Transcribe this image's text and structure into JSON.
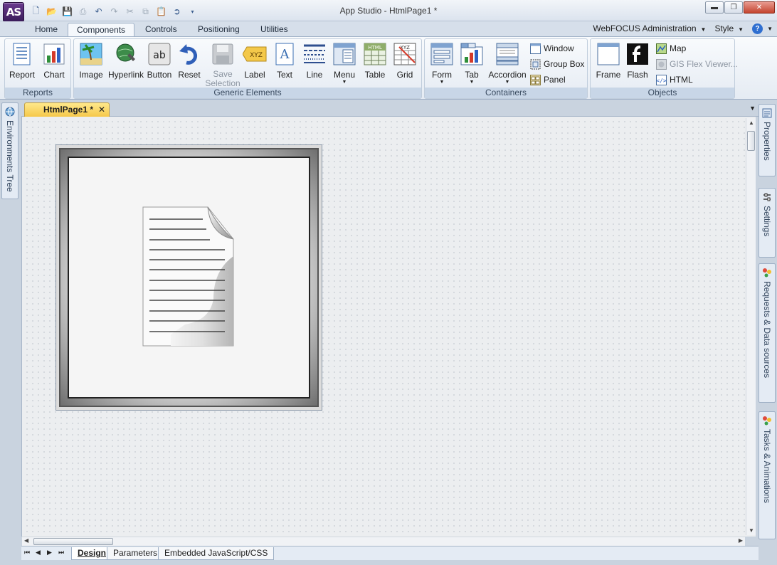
{
  "app": {
    "logo_text": "AS",
    "window_title": "App Studio - HtmlPage1 *"
  },
  "quick_access": [
    "new-icon",
    "open-icon",
    "save-icon",
    "print-icon",
    "undo-icon",
    "redo-icon",
    "cut-icon",
    "copy-icon",
    "paste-icon",
    "publish-icon",
    "more-icon"
  ],
  "window_controls": {
    "minimize": "▬",
    "restore": "❐",
    "close": "✕"
  },
  "ribbon_tabs": [
    "Home",
    "Components",
    "Controls",
    "Positioning",
    "Utilities"
  ],
  "active_tab": "Components",
  "right_menu": {
    "webfocus": "WebFOCUS Administration",
    "style": "Style",
    "help": "?"
  },
  "groups": {
    "reports": {
      "label": "Reports",
      "buttons": [
        "Report",
        "Chart"
      ]
    },
    "generic": {
      "label": "Generic Elements",
      "buttons": [
        "Image",
        "Hyperlink",
        "Button",
        "Reset",
        "Save Selection",
        "Label",
        "Text",
        "Line",
        "Menu",
        "Table",
        "Grid"
      ]
    },
    "containers": {
      "label": "Containers",
      "buttons": [
        "Form",
        "Tab",
        "Accordion"
      ],
      "small": [
        "Window",
        "Group Box",
        "Panel"
      ]
    },
    "objects": {
      "label": "Objects",
      "buttons": [
        "Frame",
        "Flash"
      ],
      "small": [
        "Map",
        "GIS Flex Viewer...",
        "HTML"
      ]
    }
  },
  "document_tab": {
    "label": "HtmlPage1 *",
    "close": "✕"
  },
  "left_dock": [
    "Environments Tree"
  ],
  "right_dock": [
    "Properties",
    "Settings",
    "Requests & Data sources",
    "Tasks & Animations"
  ],
  "bottom_tabs": [
    "Design",
    "Parameters",
    "Embedded JavaScript/CSS"
  ],
  "active_bottom_tab": "Design",
  "colors": {
    "accent": "#f5c84a",
    "ribbon_bg": "#e5ebf3",
    "canvas_bg": "#eceef0"
  }
}
